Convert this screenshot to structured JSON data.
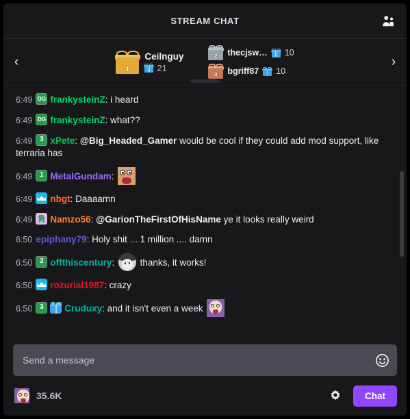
{
  "header": {
    "title": "STREAM CHAT",
    "community_icon": "community-members-icon"
  },
  "leaderboard": {
    "prev_arrow": "‹",
    "next_arrow": "›",
    "top": {
      "rank": "1",
      "name": "Ceilnguy",
      "gifts": "21"
    },
    "others": [
      {
        "rank": "2",
        "name": "thecjsw…",
        "gifts": "10"
      },
      {
        "rank": "3",
        "name": "bgriff87",
        "gifts": "10"
      }
    ]
  },
  "messages": [
    {
      "time": "6:49",
      "badges": [
        {
          "type": "sub-dg",
          "text": "DG"
        }
      ],
      "user": "frankysteinZ",
      "user_color": "#00d86b",
      "parts": [
        {
          "kind": "text",
          "text": "i heard"
        }
      ]
    },
    {
      "time": "6:49",
      "badges": [
        {
          "type": "sub-dg",
          "text": "DG"
        }
      ],
      "user": "frankysteinZ",
      "user_color": "#00d86b",
      "parts": [
        {
          "kind": "text",
          "text": "what??"
        }
      ]
    },
    {
      "time": "6:49",
      "badges": [
        {
          "type": "sub",
          "text": "3"
        }
      ],
      "user": "xPete",
      "user_color": "#00c853",
      "parts": [
        {
          "kind": "mention",
          "text": "@Big_Headed_Gamer"
        },
        {
          "kind": "text",
          "text": " would be cool if they could add mod support, like terraria has"
        }
      ]
    },
    {
      "time": "6:49",
      "badges": [
        {
          "type": "sub",
          "text": "1"
        }
      ],
      "user": "MetalGundam",
      "user_color": "#9b6cff",
      "parts": [
        {
          "kind": "emote",
          "emote": "lul-emote"
        }
      ]
    },
    {
      "time": "6:49",
      "badges": [
        {
          "type": "crown",
          "text": ""
        }
      ],
      "user": "nbgt",
      "user_color": "#ff6a2b",
      "parts": [
        {
          "kind": "text",
          "text": "Daaaamn"
        }
      ]
    },
    {
      "time": "6:49",
      "badges": [
        {
          "type": "dino",
          "text": ""
        }
      ],
      "user": "Namzo56",
      "user_color": "#ff7f2a",
      "parts": [
        {
          "kind": "mention",
          "text": "@GarionTheFirstOfHisName"
        },
        {
          "kind": "text",
          "text": " ye it looks really weird"
        }
      ]
    },
    {
      "time": "6:50",
      "badges": [],
      "user": "epiphany79",
      "user_color": "#5b5bdb",
      "parts": [
        {
          "kind": "text",
          "text": "Holy shit ... 1 million .... damn"
        }
      ]
    },
    {
      "time": "6:50",
      "badges": [
        {
          "type": "sub",
          "text": "2"
        }
      ],
      "user": "offthiscentury",
      "user_color": "#00b5a0",
      "parts": [
        {
          "kind": "emote",
          "emote": "face-emote"
        },
        {
          "kind": "text",
          "text": " thanks, it works!"
        }
      ]
    },
    {
      "time": "6:50",
      "badges": [
        {
          "type": "crown",
          "text": ""
        }
      ],
      "user": "rozurial1987",
      "user_color": "#e8142a",
      "parts": [
        {
          "kind": "text",
          "text": "crazy"
        }
      ]
    },
    {
      "time": "6:50",
      "badges": [
        {
          "type": "sub",
          "text": "3"
        },
        {
          "type": "gift",
          "text": ""
        }
      ],
      "user": "Cruduxy",
      "user_color": "#00b5a0",
      "parts": [
        {
          "kind": "text",
          "text": "and it isn't even a week "
        },
        {
          "kind": "emote",
          "emote": "pog-emote"
        }
      ]
    }
  ],
  "composer": {
    "placeholder": "Send a message",
    "value": "",
    "emoji_icon": "emoji-smiley-icon",
    "viewer_count": "35.6K",
    "viewer_icon": "viewer-emote-icon",
    "gear_icon": "settings-gear-icon",
    "chat_button": "Chat"
  },
  "colors": {
    "accent": "#9147ff",
    "background": "#18181b",
    "input_background": "#4a4a52"
  }
}
